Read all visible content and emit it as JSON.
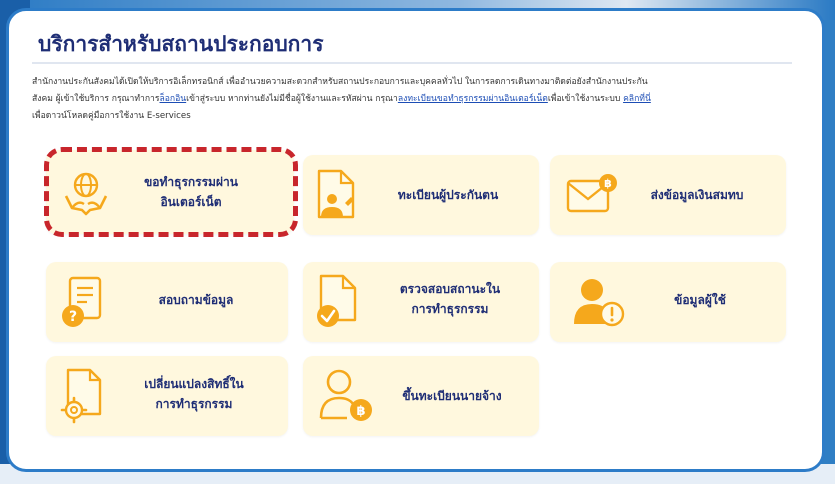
{
  "page": {
    "title": "บริการสำหรับสถานประกอบการ",
    "intro_line1": "สำนักงานประกันสังคมได้เปิดให้บริการอิเล็กทรอนิกส์ เพื่ออำนวยความสะดวกสำหรับสถานประกอบการและบุคคลทั่วไป ในการลดการเดินทางมาติดต่อยังสำนักงานประกัน",
    "intro_line2_a": "สังคม ผู้เข้าใช้บริการ กรุณาทำการ",
    "intro_link_login": "ล็อกอิน",
    "intro_line2_b": "เข้าสู่ระบบ หากท่านยังไม่มีชื่อผู้ใช้งานและรหัสผ่าน กรุณา",
    "intro_link_register": "ลงทะเบียนขอทำธุรกรรมผ่านอินเตอร์เน็ต",
    "intro_line2_c": "เพื่อเข้าใช้งานระบบ ",
    "intro_link_click": "คลิกที่นี่",
    "intro_line3": "เพื่อดาวน์โหลดคู่มือการใช้งาน E-services"
  },
  "cards": [
    {
      "label_1": "ขอทำธุรกรรมผ่าน",
      "label_2": "อินเตอร์เน็ต",
      "icon": "globe-hands-icon"
    },
    {
      "label_1": "ทะเบียนผู้ประกันตน",
      "label_2": "",
      "icon": "document-person-icon"
    },
    {
      "label_1": "ส่งข้อมูลเงินสมทบ",
      "label_2": "",
      "icon": "envelope-coin-icon"
    },
    {
      "label_1": "สอบถามข้อมูล",
      "label_2": "",
      "icon": "notebook-question-icon"
    },
    {
      "label_1": "ตรวจสอบสถานะใน",
      "label_2": "การทำธุรกรรม",
      "icon": "document-check-icon"
    },
    {
      "label_1": "ข้อมูลผู้ใช้",
      "label_2": "",
      "icon": "user-alert-icon"
    },
    {
      "label_1": "เปลี่ยนแปลงสิทธิ์ใน",
      "label_2": "การทำธุรกรรม",
      "icon": "document-gear-icon"
    },
    {
      "label_1": "ขึ้นทะเบียนนายจ้าง",
      "label_2": "",
      "icon": "user-coin-icon"
    }
  ],
  "colors": {
    "accent": "#f5a81c",
    "title": "#1e2d75",
    "card_bg": "#fff8de",
    "highlight": "#c8262c",
    "border": "#2d7cc8"
  }
}
